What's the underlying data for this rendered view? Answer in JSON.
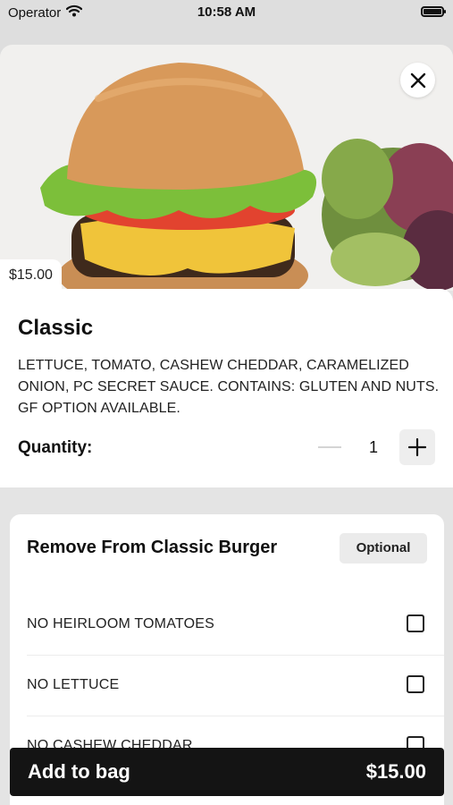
{
  "status_bar": {
    "carrier": "Operator",
    "time": "10:58 AM"
  },
  "item": {
    "price": "$15.00",
    "name": "Classic",
    "description": "LETTUCE, TOMATO, CASHEW CHEDDAR, CARAMELIZED ONION, PC SECRET SAUCE. CONTAINS: GLUTEN AND NUTS. GF OPTION AVAILABLE."
  },
  "quantity": {
    "label": "Quantity:",
    "value": "1"
  },
  "options": {
    "title": "Remove From Classic Burger",
    "badge": "Optional",
    "items": [
      {
        "label": "NO HEIRLOOM TOMATOES",
        "checked": false
      },
      {
        "label": "NO LETTUCE",
        "checked": false
      },
      {
        "label": "NO CASHEW CHEDDAR",
        "checked": false
      }
    ]
  },
  "footer": {
    "add_label": "Add to bag",
    "total": "$15.00"
  },
  "icons": [
    "wifi-icon",
    "battery-icon",
    "close-icon",
    "minus-icon",
    "plus-icon",
    "checkbox"
  ],
  "colors": {
    "primary_button": "#141414",
    "background": "#e4e4e4",
    "card": "#ffffff"
  }
}
